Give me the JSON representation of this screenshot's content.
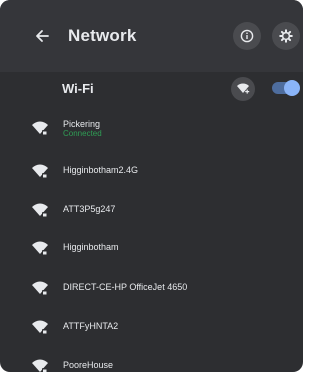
{
  "header": {
    "title": "Network"
  },
  "wifi": {
    "label": "Wi-Fi",
    "enabled": true,
    "accent": "#8ab4f8"
  },
  "networks": [
    {
      "name": "Pickering",
      "status": "Connected"
    },
    {
      "name": "Higginbotham2.4G"
    },
    {
      "name": "ATT3P5g247"
    },
    {
      "name": "Higginbotham"
    },
    {
      "name": "DIRECT-CE-HP OfficeJet 4650"
    },
    {
      "name": "ATTFyHNTA2"
    },
    {
      "name": "PooreHouse"
    }
  ],
  "colors": {
    "panel": "#2d2e31",
    "connected": "#2f9e55"
  }
}
